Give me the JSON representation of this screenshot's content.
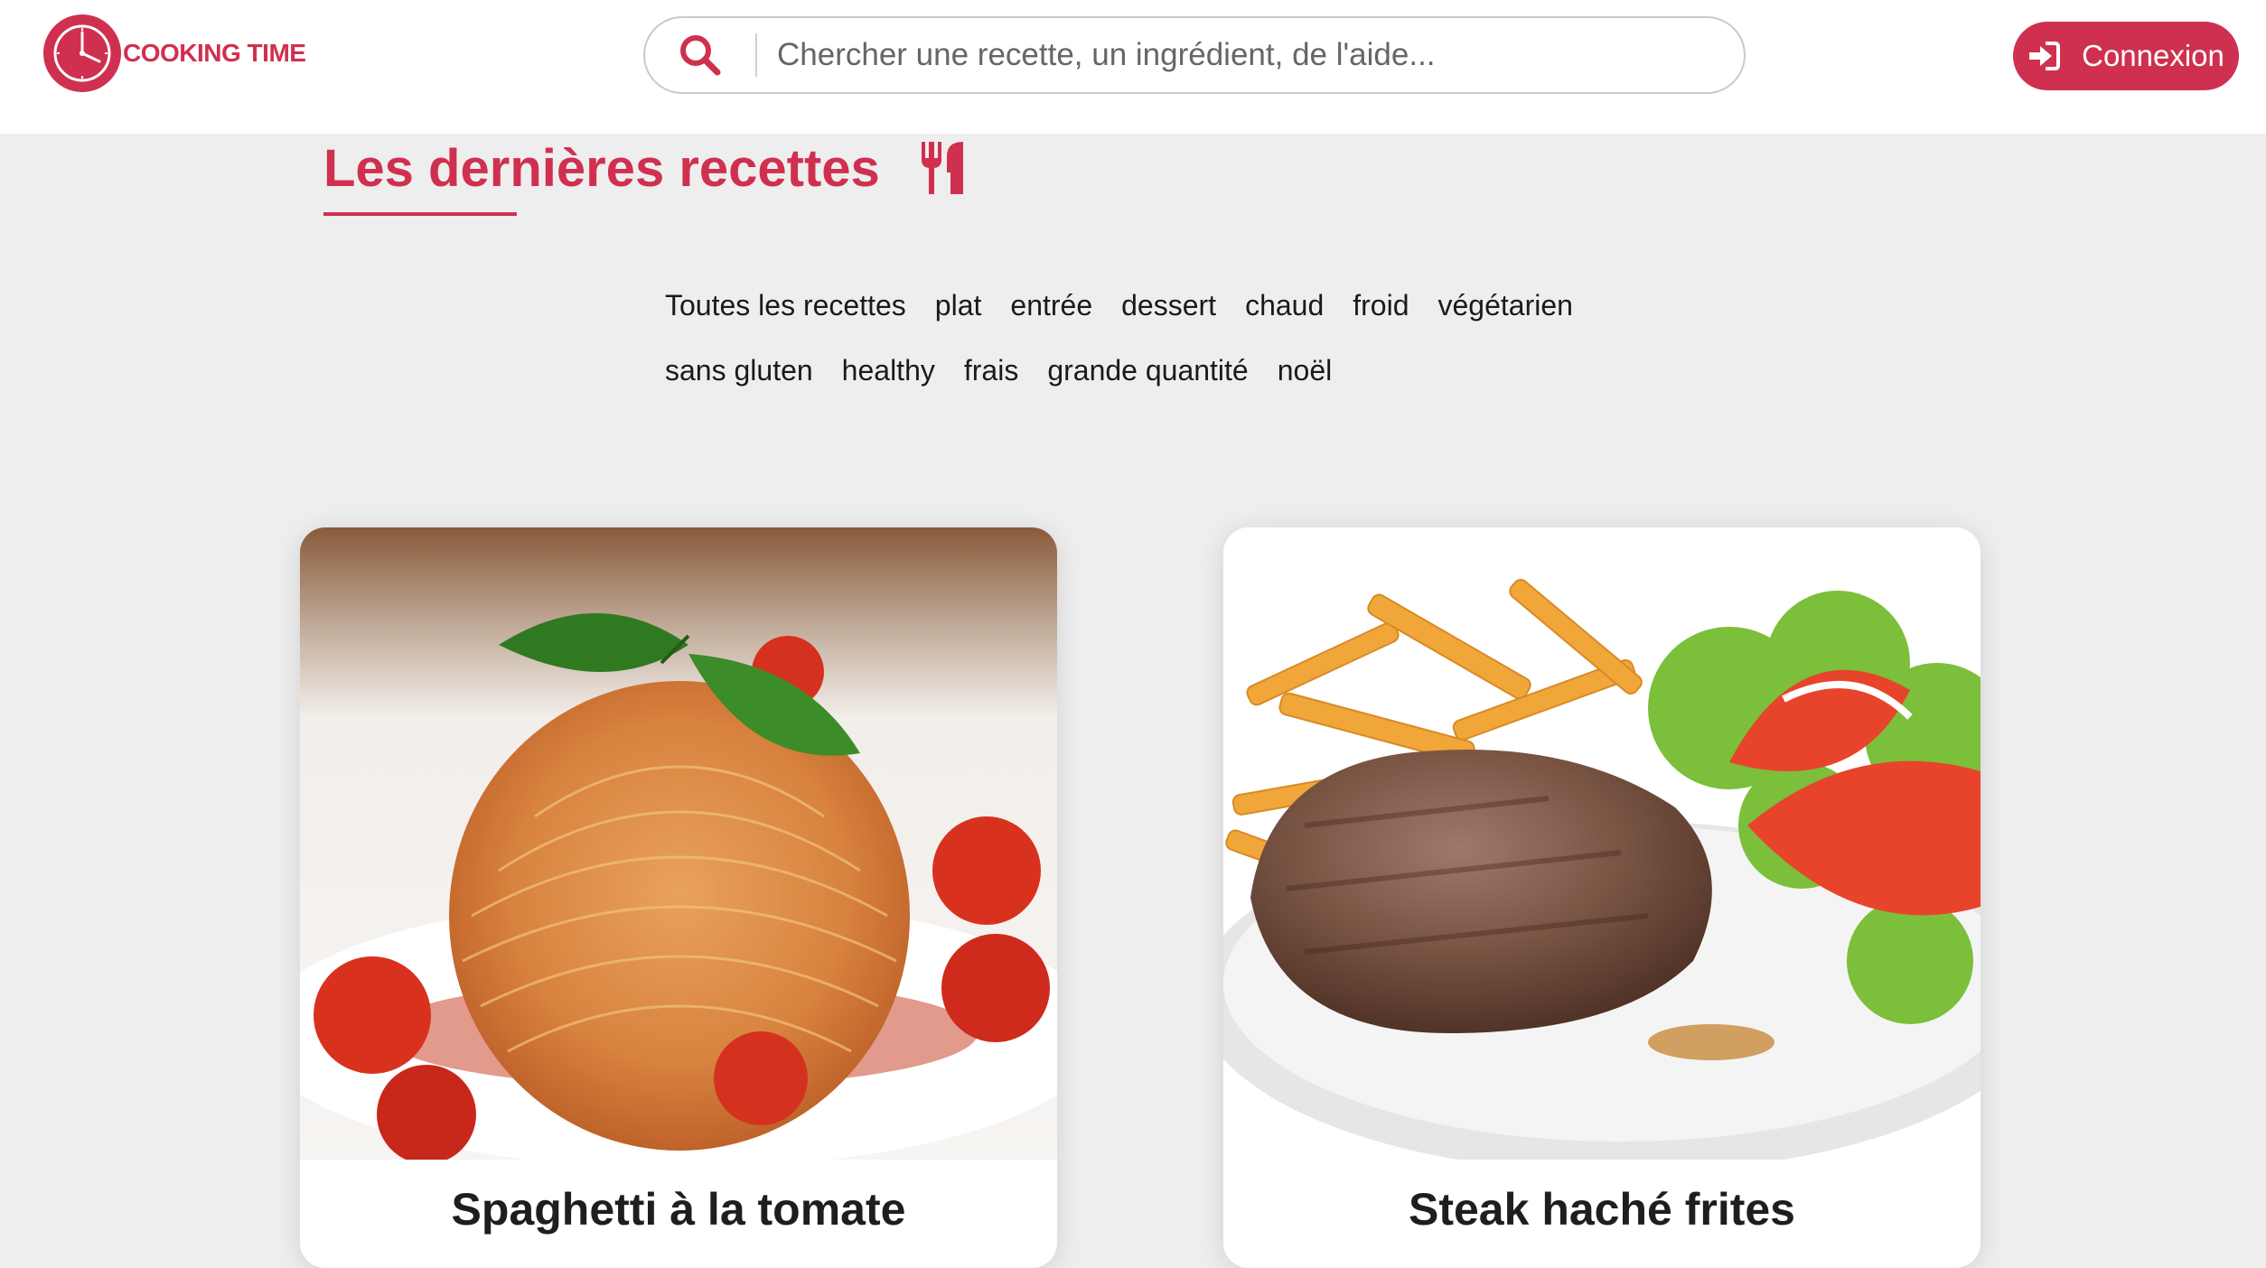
{
  "brand": {
    "name": "COOKING TIME",
    "color": "#d0304f"
  },
  "header": {
    "search": {
      "placeholder": "Chercher une recette, un ingrédient, de l'aide...",
      "value": "",
      "icon": "search-icon"
    },
    "login": {
      "label": "Connexion",
      "icon": "sign-in-icon"
    }
  },
  "section": {
    "title": "Les dernières recettes",
    "icon": "utensils-icon"
  },
  "filters": [
    "Toutes les recettes",
    "plat",
    "entrée",
    "dessert",
    "chaud",
    "froid",
    "végétarien",
    "sans gluten",
    "healthy",
    "frais",
    "grande quantité",
    "noël"
  ],
  "recipes": [
    {
      "title": "Spaghetti à la tomate",
      "image": "spaghetti-photo"
    },
    {
      "title": "Steak haché frites",
      "image": "steak-frites-photo"
    }
  ]
}
